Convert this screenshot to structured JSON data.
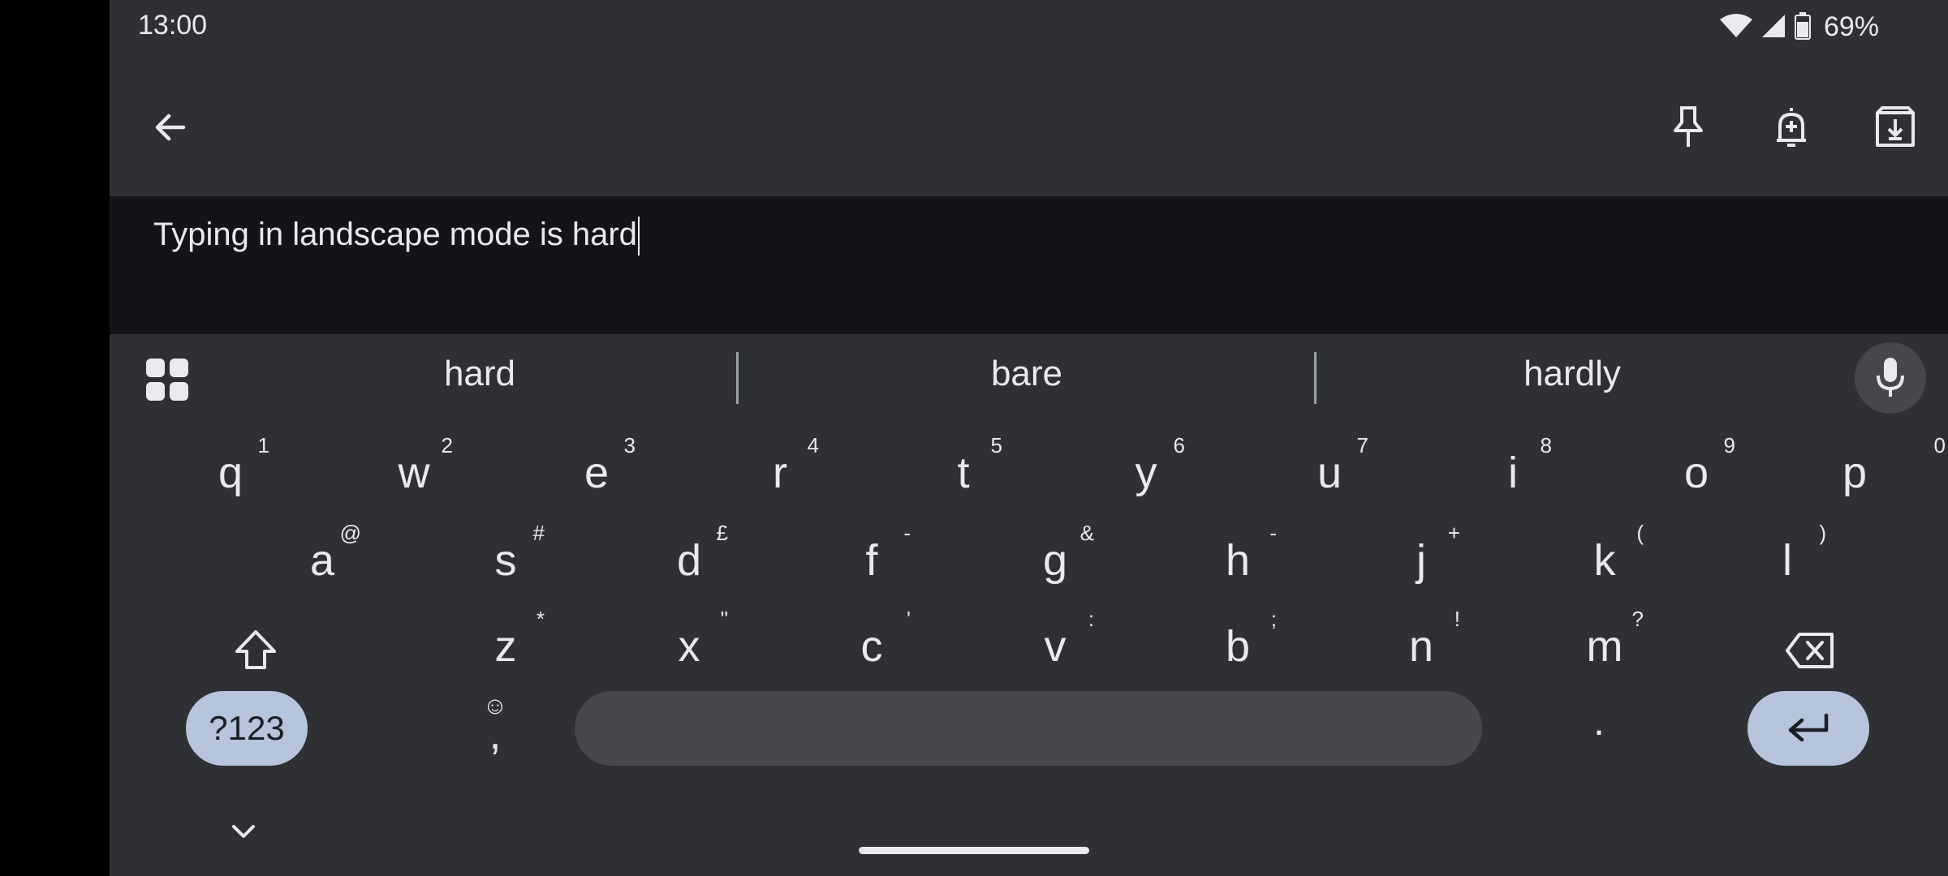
{
  "status_bar": {
    "time": "13:00",
    "battery_percent": "69%",
    "icons": [
      "wifi-icon",
      "cell-signal-icon",
      "battery-icon"
    ]
  },
  "app_bar": {
    "icons": [
      "back-arrow-icon",
      "pin-icon",
      "add-reminder-icon",
      "archive-icon"
    ]
  },
  "note": {
    "text": "Typing in landscape mode is hard"
  },
  "keyboard": {
    "suggestions": [
      "hard",
      "bare",
      "hardly"
    ],
    "row1": [
      {
        "key": "q",
        "hint": "1"
      },
      {
        "key": "w",
        "hint": "2"
      },
      {
        "key": "e",
        "hint": "3"
      },
      {
        "key": "r",
        "hint": "4"
      },
      {
        "key": "t",
        "hint": "5"
      },
      {
        "key": "y",
        "hint": "6"
      },
      {
        "key": "u",
        "hint": "7"
      },
      {
        "key": "i",
        "hint": "8"
      },
      {
        "key": "o",
        "hint": "9"
      },
      {
        "key": "p",
        "hint": "0"
      }
    ],
    "row2": [
      {
        "key": "a",
        "hint": "@"
      },
      {
        "key": "s",
        "hint": "#"
      },
      {
        "key": "d",
        "hint": "£"
      },
      {
        "key": "f",
        "hint": "-"
      },
      {
        "key": "g",
        "hint": "&"
      },
      {
        "key": "h",
        "hint": "-"
      },
      {
        "key": "j",
        "hint": "+"
      },
      {
        "key": "k",
        "hint": "("
      },
      {
        "key": "l",
        "hint": ")"
      }
    ],
    "row3": [
      {
        "key": "z",
        "hint": "*"
      },
      {
        "key": "x",
        "hint": "\""
      },
      {
        "key": "c",
        "hint": "'"
      },
      {
        "key": "v",
        "hint": ":"
      },
      {
        "key": "b",
        "hint": ";"
      },
      {
        "key": "n",
        "hint": "!"
      },
      {
        "key": "m",
        "hint": "?"
      }
    ],
    "symbols_label": "?123",
    "comma": ",",
    "period": ".",
    "accent_color": "#b6c5dc"
  }
}
